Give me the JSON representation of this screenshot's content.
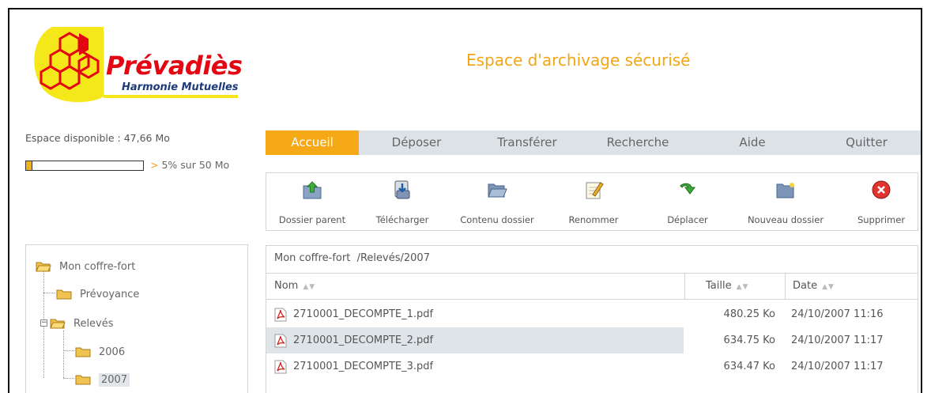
{
  "brand": {
    "name": "Prévadiès",
    "tagline": "Harmonie Mutuelles"
  },
  "header": {
    "title": "Espace d'archivage sécurisé"
  },
  "quota": {
    "label": "Espace disponible : 47,66 Mo",
    "gt": ">",
    "text": "5% sur 50 Mo",
    "used_fraction": 0.05
  },
  "tabs": [
    {
      "label": "Accueil",
      "active": true
    },
    {
      "label": "Déposer"
    },
    {
      "label": "Transférer"
    },
    {
      "label": "Recherche"
    },
    {
      "label": "Aide"
    },
    {
      "label": "Quitter"
    }
  ],
  "toolbar": [
    {
      "label": "Dossier parent",
      "icon": "folder-up-icon"
    },
    {
      "label": "Télécharger",
      "icon": "download-icon"
    },
    {
      "label": "Contenu dossier",
      "icon": "folder-open-icon"
    },
    {
      "label": "Renommer",
      "icon": "rename-icon"
    },
    {
      "label": "Déplacer",
      "icon": "move-icon"
    },
    {
      "label": "Nouveau dossier",
      "icon": "new-folder-icon"
    },
    {
      "label": "Supprimer",
      "icon": "delete-icon"
    }
  ],
  "tree": {
    "root": "Mon coffre-fort",
    "items": [
      {
        "label": "Prévoyance"
      },
      {
        "label": "Relevés",
        "expanded": true,
        "expander": "−"
      },
      {
        "label": "2006"
      },
      {
        "label": "2007",
        "selected": true
      }
    ]
  },
  "files": {
    "path_root": "Mon coffre-fort",
    "path": "/Relevés/2007",
    "columns": {
      "name": "Nom",
      "size": "Taille",
      "date": "Date"
    },
    "sort_glyph": "▲▼",
    "rows": [
      {
        "name": "2710001_DECOMPTE_1.pdf",
        "size": "480.25 Ko",
        "date": "24/10/2007 11:16",
        "selected": false
      },
      {
        "name": "2710001_DECOMPTE_2.pdf",
        "size": "634.75 Ko",
        "date": "24/10/2007 11:17",
        "selected": true
      },
      {
        "name": "2710001_DECOMPTE_3.pdf",
        "size": "634.47 Ko",
        "date": "24/10/2007 11:17",
        "selected": false
      }
    ]
  },
  "colors": {
    "accent": "#f5a916",
    "brand_red": "#e30613",
    "title": "#f2a516"
  }
}
